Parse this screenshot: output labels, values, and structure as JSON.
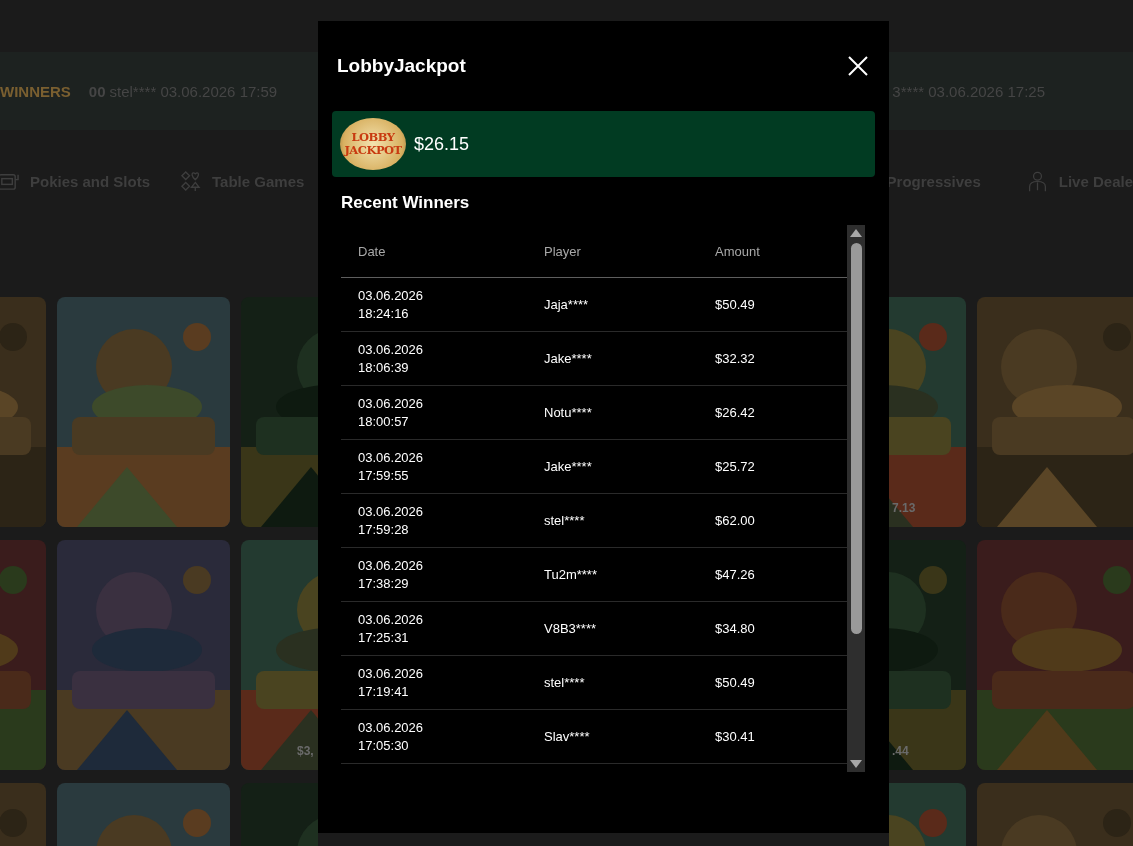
{
  "ticker": {
    "label": "WINNERS",
    "items": [
      {
        "amount": "00",
        "text": "stel**** 03.06.2026 17:59"
      },
      {
        "text": "3**** 03.06.2026 17:25"
      }
    ]
  },
  "nav": {
    "left": [
      {
        "kind": "slots",
        "label": "Pokies and Slots"
      },
      {
        "kind": "cards",
        "label": "Table Games"
      }
    ],
    "right": [
      {
        "kind": "plain",
        "label": "Progressives"
      },
      {
        "kind": "dealer",
        "label": "Live Deale"
      }
    ]
  },
  "tiles": {
    "left": [
      [
        {
          "kind": "picture"
        },
        {
          "kind": "picture"
        },
        {
          "kind": "picture"
        }
      ],
      [
        {
          "kind": "picture"
        },
        {
          "kind": "picture"
        },
        {
          "kind": "picture",
          "label": "$3,"
        }
      ],
      [
        {
          "kind": "picture"
        },
        {
          "kind": "picture"
        },
        {
          "kind": "picture"
        }
      ]
    ],
    "right": [
      [
        {
          "kind": "picture",
          "label": "7.13"
        },
        {
          "kind": "picture"
        }
      ],
      [
        {
          "kind": "picture",
          "label": ".44"
        },
        {
          "kind": "picture"
        }
      ],
      [
        {
          "kind": "picture"
        },
        {
          "kind": "picture"
        }
      ]
    ]
  },
  "modal": {
    "title": "LobbyJackpot",
    "logo_text": "LOBBY JACKPOT",
    "amount": "$26.15",
    "section_title": "Recent Winners",
    "table": {
      "columns": [
        "Date",
        "Player",
        "Amount"
      ],
      "rows": [
        {
          "date": "03.06.2026",
          "time": "18:24:16",
          "player": "Jaja****",
          "amount": "$50.49"
        },
        {
          "date": "03.06.2026",
          "time": "18:06:39",
          "player": "Jake****",
          "amount": "$32.32"
        },
        {
          "date": "03.06.2026",
          "time": "18:00:57",
          "player": "Notu****",
          "amount": "$26.42"
        },
        {
          "date": "03.06.2026",
          "time": "17:59:55",
          "player": "Jake****",
          "amount": "$25.72"
        },
        {
          "date": "03.06.2026",
          "time": "17:59:28",
          "player": "stel****",
          "amount": "$62.00"
        },
        {
          "date": "03.06.2026",
          "time": "17:38:29",
          "player": "Tu2m****",
          "amount": "$47.26"
        },
        {
          "date": "03.06.2026",
          "time": "17:25:31",
          "player": "V8B3****",
          "amount": "$34.80"
        },
        {
          "date": "03.06.2026",
          "time": "17:19:41",
          "player": "stel****",
          "amount": "$50.49"
        },
        {
          "date": "03.06.2026",
          "time": "17:05:30",
          "player": "Slav****",
          "amount": "$30.41"
        }
      ]
    }
  }
}
